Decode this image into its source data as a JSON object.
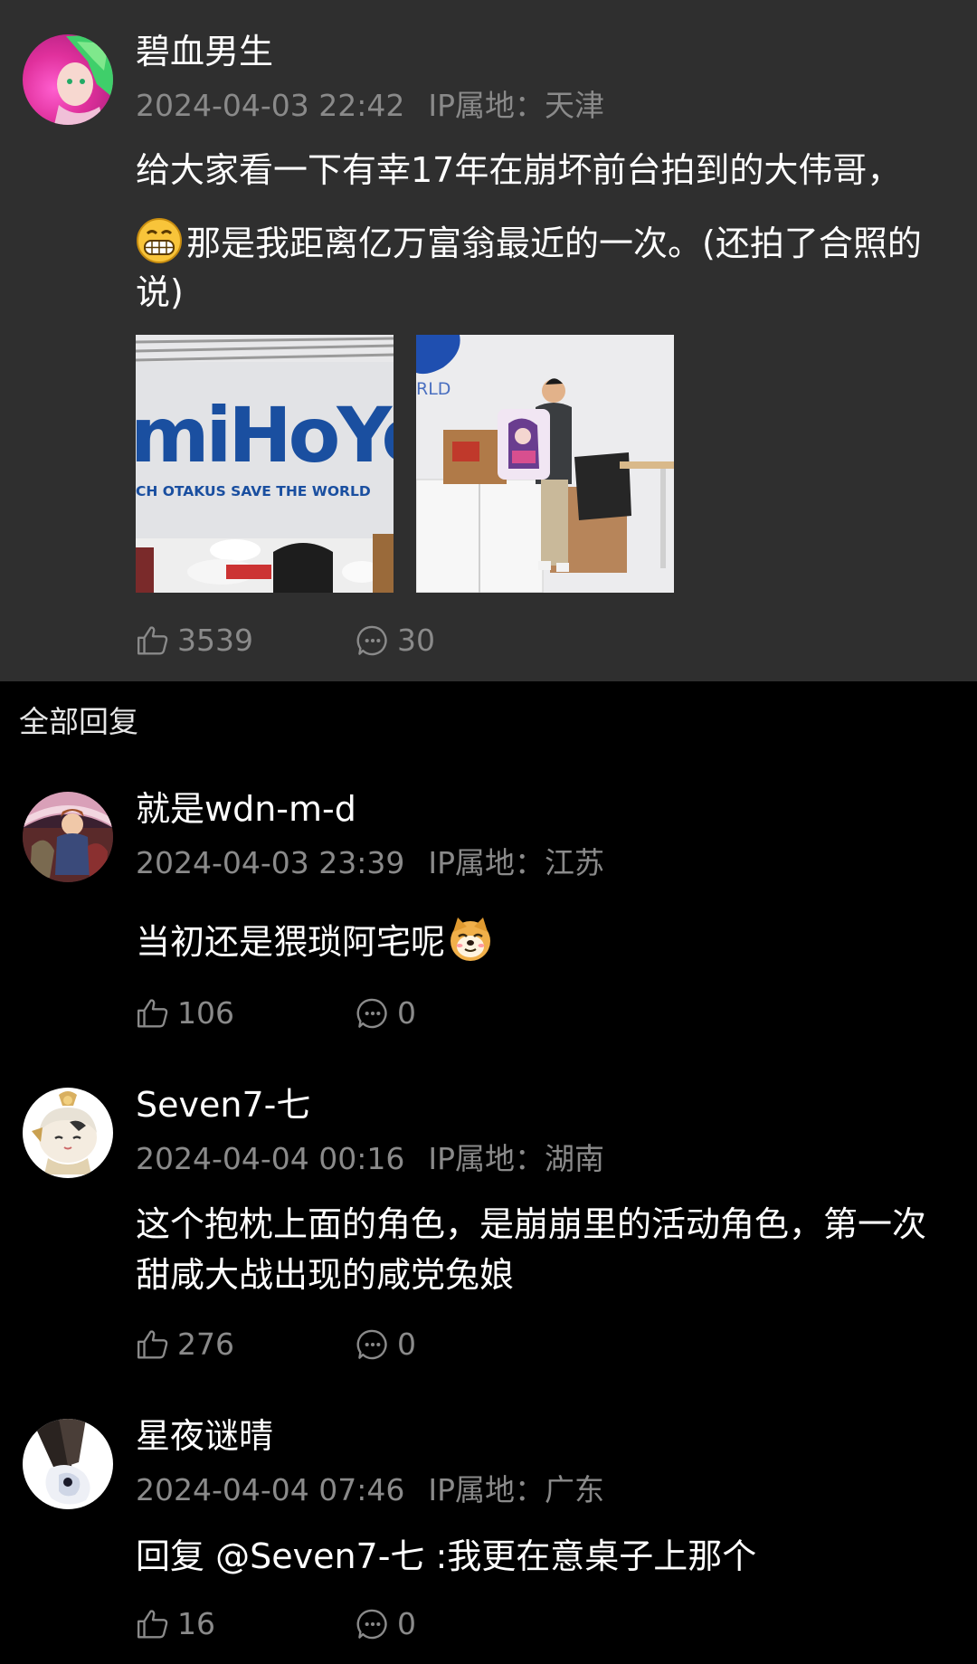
{
  "post": {
    "user": "碧血男生",
    "time": "2024-04-03 22:42",
    "ip": "IP属地：天津",
    "text_line1": "给大家看一下有幸17年在崩坏前台拍到的大伟哥，",
    "text_line2": "那是我距离亿万富翁最近的一次。(还拍了合照的说)",
    "emoji": "grin-emoji",
    "likes": "3539",
    "comments": "30",
    "images": [
      {
        "desc": "mihoyo-logo-wall",
        "logo_text": "miHoYo",
        "slogan": "CH OTAKUS SAVE THE WORLD"
      },
      {
        "desc": "person-holding-pillow",
        "wall_text": "RLD"
      }
    ]
  },
  "section": {
    "title": "全部回复"
  },
  "replies": [
    {
      "user": "就是wdn-m-d",
      "time": "2024-04-03 23:39",
      "ip": "IP属地：江苏",
      "text": "当初还是猥琐阿宅呢",
      "emoji": "doge-emoji",
      "likes": "106",
      "comments": "0"
    },
    {
      "user": "Seven7-七",
      "time": "2024-04-04 00:16",
      "ip": "IP属地：湖南",
      "text": "这个抱枕上面的角色，是崩崩里的活动角色，第一次甜咸大战出现的咸党兔娘",
      "likes": "276",
      "comments": "0"
    },
    {
      "user": "星夜谜晴",
      "time": "2024-04-04 07:46",
      "ip": "IP属地：广东",
      "text": "回复 @Seven7-七 :我更在意桌子上那个",
      "likes": "16",
      "comments": "0"
    }
  ],
  "colors": {
    "post_bg": "#2f2f2f",
    "page_bg": "#000000",
    "meta": "#8a8a8a",
    "text": "#ffffff"
  }
}
